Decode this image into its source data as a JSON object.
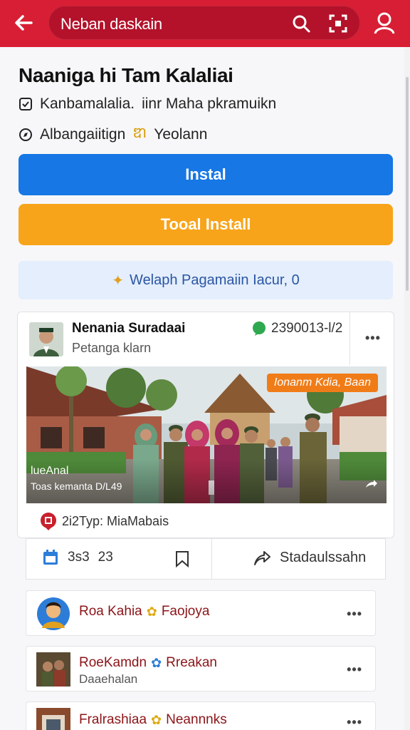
{
  "topbar": {
    "search_text": "Neban daskain",
    "colors": {
      "bar": "#d81e34",
      "field": "#b3122a"
    }
  },
  "app": {
    "title": "Naaniga hi Tam Kalaliai",
    "developer_prefix": "Kanbamalalia.",
    "developer_suffix": "iinr Maha pkramuikn",
    "category_prefix": "Albangaiitign",
    "category_highlight": "ឌា",
    "category_suffix": "Yeolann"
  },
  "buttons": {
    "install": "Instal",
    "total_install": "Tooal Install"
  },
  "promo": {
    "icon_glyph": "✦",
    "text": "Welaph Pagamaiin Iacur, 0"
  },
  "post": {
    "author": "Nenania Suradaai",
    "subtitle": "Petanga klarn",
    "stat": "2390013-l/2",
    "more": "•••",
    "photo_badge": "Ionanm Kdia, Baan",
    "photo_caption_1": "lueAnal",
    "photo_caption_2": "Toas kemanta D/L49",
    "footer_text": "2i2Typ: MiaMabais"
  },
  "actions": {
    "count_a": "3s3",
    "count_b": "23",
    "share_label": "Stadaulssahn"
  },
  "list": [
    {
      "name": "Roa Kahia",
      "badge": "✿",
      "tag": "Faojoya",
      "sub": "",
      "more": "•••"
    },
    {
      "name": "RoeKamdn",
      "badge": "✿",
      "tag": "Rreakan",
      "sub": "Daaehalan",
      "more": "•••"
    },
    {
      "name": "Fralrashiaa",
      "badge": "✿",
      "tag": "Neannnks",
      "sub": "",
      "more": "•••"
    }
  ]
}
